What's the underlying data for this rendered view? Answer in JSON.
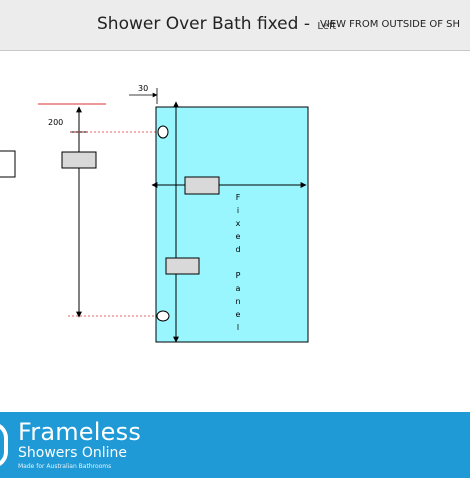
{
  "header": {
    "title": "Shower Over Bath fixed - ",
    "side": "Left",
    "view": "VIEW FROM OUTSIDE OF SH"
  },
  "diagram": {
    "dim_top": "30",
    "dim_left": "200",
    "panel_label": [
      "F",
      "i",
      "x",
      "e",
      "d",
      "",
      "P",
      "a",
      "n",
      "e",
      "l"
    ],
    "colors": {
      "glass": "#99f6ff",
      "hinge": "#d9d9d9",
      "guide": "#e03030",
      "line": "#000000"
    }
  },
  "footer": {
    "brand": "Frameless",
    "subbrand": "Showers Online",
    "tagline": "Made for Australian Bathrooms",
    "color": "#1f9ad6"
  }
}
